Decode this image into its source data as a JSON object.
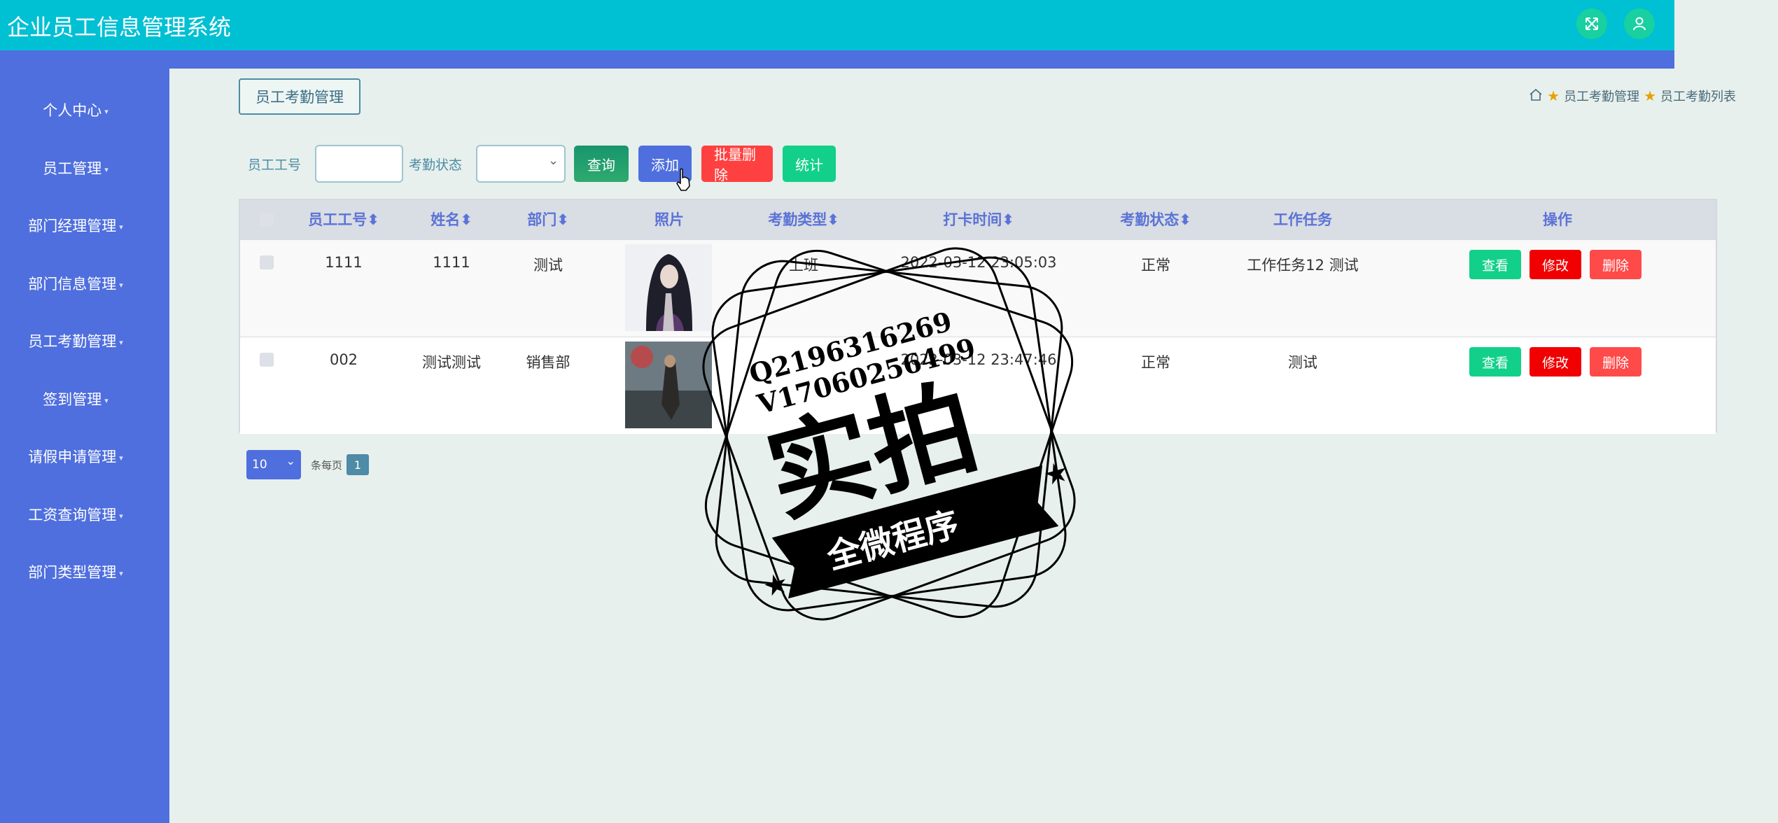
{
  "app": {
    "title": "企业员工信息管理系统"
  },
  "topbar": {
    "fullscreen_icon": "expand-icon",
    "user_icon": "user-icon"
  },
  "sidebar": {
    "items": [
      {
        "label": "个人中心"
      },
      {
        "label": "员工管理"
      },
      {
        "label": "部门经理管理"
      },
      {
        "label": "部门信息管理"
      },
      {
        "label": "员工考勤管理"
      },
      {
        "label": "签到管理"
      },
      {
        "label": "请假申请管理"
      },
      {
        "label": "工资查询管理"
      },
      {
        "label": "部门类型管理"
      }
    ]
  },
  "section": {
    "title": "员工考勤管理"
  },
  "breadcrumb": {
    "level1": "员工考勤管理",
    "level2": "员工考勤列表"
  },
  "search": {
    "employee_id_label": "员工工号",
    "employee_id_value": "",
    "status_label": "考勤状态",
    "status_value": "",
    "query_label": "查询",
    "add_label": "添加",
    "bulk_delete_label": "批量删除",
    "stats_label": "统计"
  },
  "table": {
    "headers": {
      "employee_id": "员工工号",
      "name": "姓名",
      "department": "部门",
      "photo": "照片",
      "attendance_type": "考勤类型",
      "clock_time": "打卡时间",
      "status": "考勤状态",
      "task": "工作任务",
      "actions": "操作"
    },
    "rows": [
      {
        "employee_id": "1111",
        "name": "1111",
        "department": "测试",
        "attendance_type": "上班",
        "clock_time": "2022-03-12 23:05:03",
        "status": "正常",
        "task": "工作任务12 测试"
      },
      {
        "employee_id": "002",
        "name": "测试测试",
        "department": "销售部",
        "attendance_type": "",
        "clock_time": "2022-03-12 23:47:46",
        "status": "正常",
        "task": "测试"
      }
    ],
    "actions": {
      "view": "查看",
      "edit": "修改",
      "delete": "删除"
    }
  },
  "pagination": {
    "page_size": "10",
    "per_page_text": "条每页",
    "current_page": "1"
  },
  "watermark": {
    "line1": "Q2196316269",
    "line2": "V17060256499",
    "main": "实拍",
    "sub": "全微程序"
  }
}
